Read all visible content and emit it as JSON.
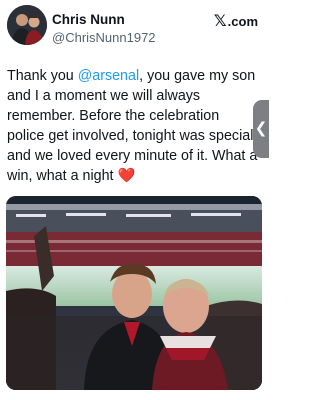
{
  "author": {
    "display_name": "Chris Nunn",
    "handle": "@ChrisNunn1972"
  },
  "platform": {
    "logo_text": ".com",
    "logo_mark": "𝕏"
  },
  "tweet": {
    "text_before_mention": "Thank you ",
    "mention": "@arsenal",
    "text_after_mention": ", you gave my son and I a moment we will always remember. Before the celebration police get involved, tonight was special and we loved every minute of it. What a win, what a night ",
    "emoji": "❤️"
  },
  "side_tab": {
    "glyph": "❮"
  },
  "media": {
    "icon": "stadium-selfie-photo"
  }
}
